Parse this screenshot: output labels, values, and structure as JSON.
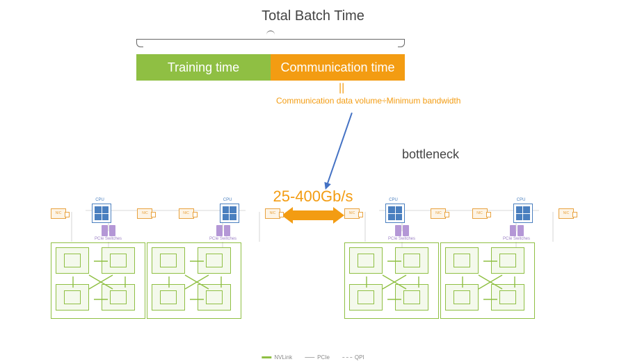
{
  "title": "Total Batch Time",
  "bar": {
    "training": "Training time",
    "communication": "Communication time"
  },
  "equals": "||",
  "formula": "Communication data volume÷Minimum bandwidth",
  "bottleneck_label": "bottleneck",
  "bandwidth": "25-400Gb/s",
  "cluster": {
    "nic": "NIC",
    "cpu": "CPU",
    "pcie": "PCIe Switches"
  },
  "legend": {
    "nvlink": "NVLink",
    "pcie": "PCIe",
    "qpi": "QPI"
  },
  "diagram_data": {
    "type": "architecture",
    "description": "Two identical GPU server nodes connected over network. Each node: 2 CPUs, 4 NICs, 2 PCIe switch pairs, 2 groups of 4 GPUs (8 GPUs total per node). GPUs within a group fully connected via NVLink. Inter-node bandwidth 25-400 Gb/s is the bottleneck determining communication time.",
    "batch_time_components": [
      "Training time",
      "Communication time"
    ],
    "communication_time_formula": "Communication data volume ÷ Minimum bandwidth",
    "inter_node_bandwidth_gbps": {
      "min": 25,
      "max": 400
    },
    "node_count": 2,
    "per_node": {
      "cpus": 2,
      "nics": 4,
      "pcie_switch_pairs": 2,
      "gpu_groups": 2,
      "gpus_per_group": 4,
      "gpus_total": 8
    },
    "link_types": [
      "NVLink",
      "PCIe",
      "QPI"
    ]
  }
}
